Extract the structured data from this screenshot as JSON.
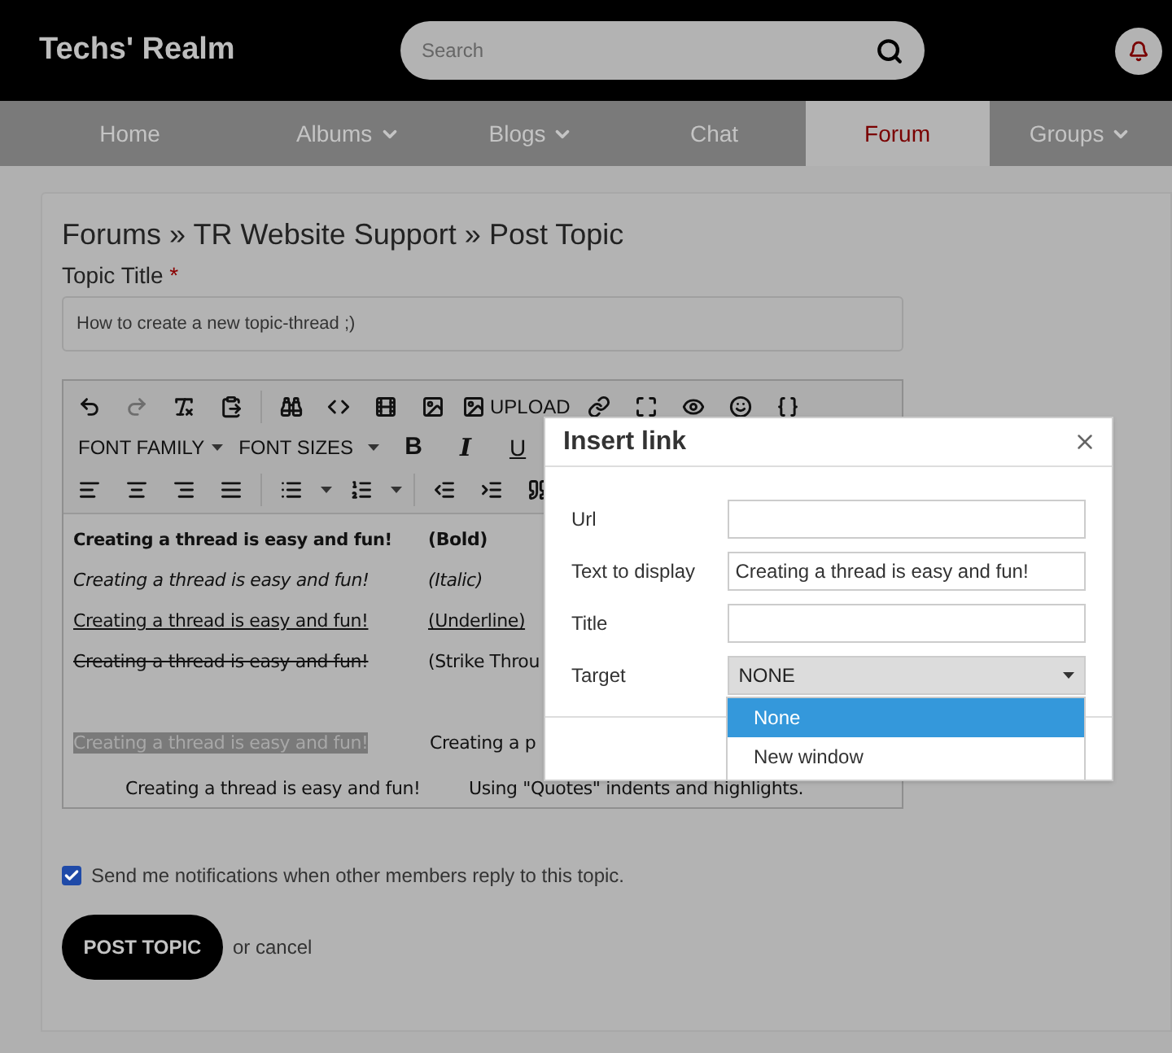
{
  "header": {
    "logo": "Techs' Realm",
    "search": {
      "placeholder": "Search"
    }
  },
  "nav": [
    {
      "label": "Home",
      "selected": false,
      "has_menu": false
    },
    {
      "label": "Albums",
      "selected": false,
      "has_menu": true
    },
    {
      "label": "Blogs",
      "selected": false,
      "has_menu": true
    },
    {
      "label": "Chat",
      "selected": false,
      "has_menu": false
    },
    {
      "label": "Forum",
      "selected": true,
      "has_menu": false
    },
    {
      "label": "Groups",
      "selected": false,
      "has_menu": true
    }
  ],
  "breadcrumb": "Forums » TR Website Support » Post Topic",
  "topic_title": {
    "label": "Topic Title",
    "required_mark": "*",
    "value": "How to create a new topic-thread ;)"
  },
  "editor": {
    "toolbar": {
      "upload": "UPLOAD",
      "font_family": "FONT FAMILY",
      "font_sizes": "FONT SIZES",
      "bold": "B",
      "italic": "I",
      "underline": "U"
    },
    "lines": [
      {
        "kind": "bold",
        "text": "Creating a thread is easy and fun!",
        "note": "(Bold)"
      },
      {
        "kind": "italic",
        "text": "Creating a thread is easy and fun!",
        "note": "(Italic)"
      },
      {
        "kind": "underline",
        "text": "Creating a thread is easy and fun!",
        "note": "(Underline)"
      },
      {
        "kind": "strike",
        "text": "Creating a thread is easy and fun!",
        "note": "(Strike Throu"
      },
      {
        "kind": "blank"
      },
      {
        "kind": "highlight",
        "text": "Creating a thread is easy and fun!",
        "note": "Creating a p"
      },
      {
        "kind": "quote",
        "text": "Creating a thread is easy and fun!",
        "note": "Using \"Quotes\" indents and highlights."
      }
    ]
  },
  "notify": {
    "label": "Send me notifications when other members reply to this topic.",
    "checked": true
  },
  "post_button": "POST TOPIC",
  "cancel": "or cancel",
  "dialog": {
    "title": "Insert link",
    "fields": [
      {
        "label": "Url"
      },
      {
        "label": "Text to display",
        "value": "Creating a thread is easy and fun!"
      },
      {
        "label": "Title"
      }
    ],
    "target": {
      "label": "Target",
      "value": "NONE",
      "options": [
        {
          "label": "None",
          "selected": true
        },
        {
          "label": "New window",
          "selected": false
        }
      ]
    }
  }
}
